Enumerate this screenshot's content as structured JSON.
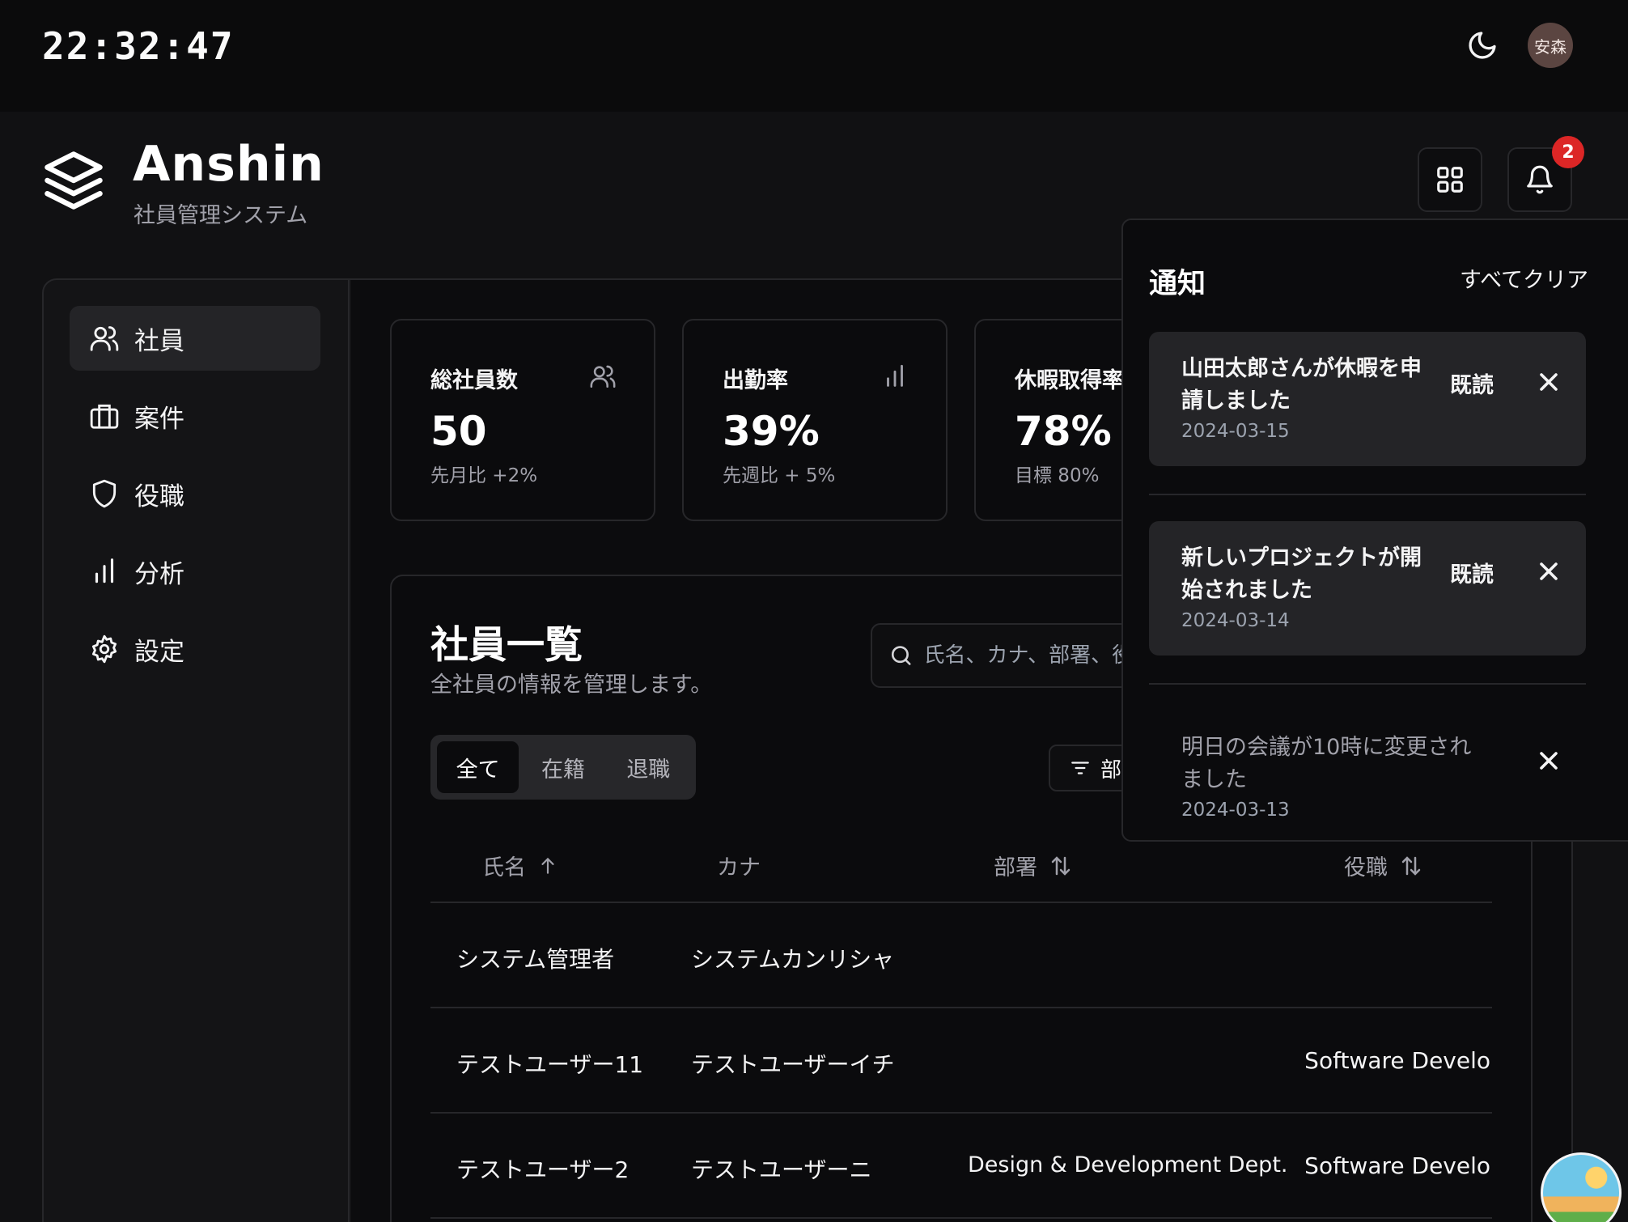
{
  "topbar": {
    "clock": "22:32:47",
    "avatar_text": "安森"
  },
  "brand": {
    "name": "Anshin",
    "subtitle": "社員管理システム"
  },
  "notifications_badge": "2",
  "sidebar": {
    "items": [
      {
        "label": "社員",
        "icon": "users-icon",
        "active": true
      },
      {
        "label": "案件",
        "icon": "briefcase-icon"
      },
      {
        "label": "役職",
        "icon": "shield-icon"
      },
      {
        "label": "分析",
        "icon": "bar-chart-icon"
      },
      {
        "label": "設定",
        "icon": "gear-icon"
      }
    ]
  },
  "stats": [
    {
      "title": "総社員数",
      "value": "50",
      "note": "先月比 +2%",
      "icon": "users-icon"
    },
    {
      "title": "出勤率",
      "value": "39%",
      "note": "先週比 + 5%",
      "icon": "bar-chart-icon"
    },
    {
      "title": "休暇取得率",
      "value": "78%",
      "note": "目標 80%"
    }
  ],
  "employees": {
    "title": "社員一覧",
    "subtitle": "全社員の情報を管理します。",
    "search_placeholder": "氏名、カナ、部署、役職で検索",
    "tabs": [
      {
        "label": "全て",
        "active": true
      },
      {
        "label": "在籍"
      },
      {
        "label": "退職"
      }
    ],
    "dept_filter_label": "部署",
    "columns": [
      "氏名",
      "カナ",
      "部署",
      "役職"
    ],
    "rows": [
      {
        "name": "システム管理者",
        "kana": "システムカンリシャ",
        "department": "",
        "position": ""
      },
      {
        "name": "テストユーザー11",
        "kana": "テストユーザーイチ",
        "department": "",
        "position": "Software Develo"
      },
      {
        "name": "テストユーザー2",
        "kana": "テストユーザーニ",
        "department": "Design & Development Dept.",
        "position": "Software Develo"
      }
    ]
  },
  "notifications": {
    "title": "通知",
    "clear_all": "すべてクリア",
    "mark_read": "既読",
    "items": [
      {
        "message": "山田太郎さんが休暇を申請しました",
        "date": "2024-03-15",
        "unread": true
      },
      {
        "message": "新しいプロジェクトが開始されました",
        "date": "2024-03-14",
        "unread": true
      },
      {
        "message": "明日の会議が10時に変更されました",
        "date": "2024-03-13",
        "unread": false
      }
    ]
  },
  "colors": {
    "background": "#0c0c0e",
    "accent_badge": "#dc2626",
    "muted_text": "#a1a1aa",
    "border": "#27272a"
  }
}
